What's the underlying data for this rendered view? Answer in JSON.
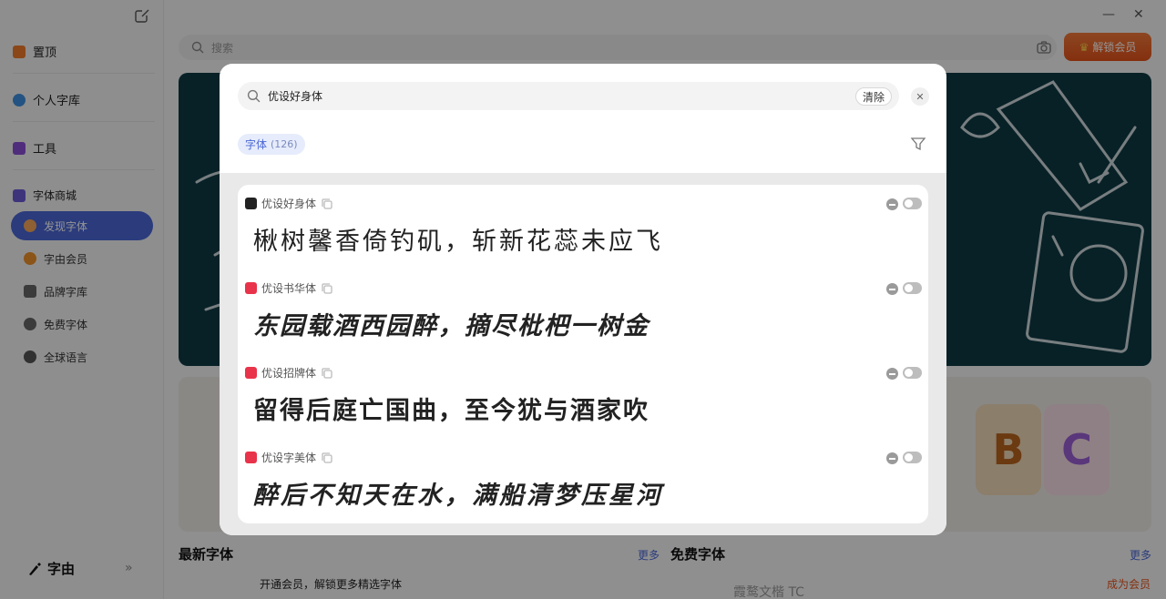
{
  "sidebar": {
    "pinned_label": "置顶",
    "personal_library_label": "个人字库",
    "tools_label": "工具",
    "store": {
      "title": "字体商城",
      "items": [
        {
          "label": "发现字体",
          "active": true
        },
        {
          "label": "字由会员"
        },
        {
          "label": "品牌字库"
        },
        {
          "label": "免费字体"
        },
        {
          "label": "全球语言"
        }
      ]
    },
    "brand_label": "字由"
  },
  "header": {
    "search_placeholder": "搜索",
    "vip_button_label": "解锁会员"
  },
  "background": {
    "latest_fonts_title": "最新字体",
    "latest_more": "更多",
    "free_fonts_title": "免费字体",
    "free_more": "更多",
    "promo_text": "开通会员，解锁更多精选字体",
    "become_vip": "成为会员",
    "free_font_name": "霞鹜文楷 TC",
    "abc_letters": [
      "B",
      "C"
    ]
  },
  "modal": {
    "search_value": "优设好身体",
    "clear_label": "清除",
    "filter_chip": {
      "label": "字体",
      "count": "(126)"
    },
    "results": [
      {
        "name": "优设好身体",
        "sample": "楸树馨香倚钓矶，斩新花蕊未应飞",
        "logo_color": "#222222"
      },
      {
        "name": "优设书华体",
        "sample": "东园载酒西园醉，摘尽枇杷一树金",
        "logo_color": "#e8334a"
      },
      {
        "name": "优设招牌体",
        "sample": "留得后庭亡国曲，至今犹与酒家吹",
        "logo_color": "#e8334a"
      },
      {
        "name": "优设字美体",
        "sample": "醉后不知天在水，满船清梦压星河",
        "logo_color": "#e8334a"
      }
    ]
  },
  "colors": {
    "accent": "#4a67d6",
    "vip_orange": "#e3521a"
  }
}
